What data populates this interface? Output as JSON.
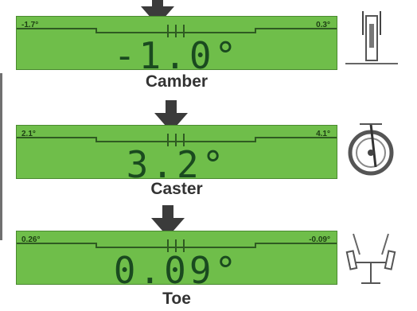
{
  "readouts": [
    {
      "id": "camber",
      "label": "Camber",
      "value": "-1.0°",
      "min_label": "-1.7°",
      "max_label": "0.3°"
    },
    {
      "id": "caster",
      "label": "Caster",
      "value": "3.2°",
      "min_label": "2.1°",
      "max_label": "4.1°"
    },
    {
      "id": "toe",
      "label": "Toe",
      "value": "0.09°",
      "min_label": "0.26°",
      "max_label": "-0.09°"
    }
  ],
  "colors": {
    "gauge_bg": "#6fbe4a",
    "gauge_text": "#1a4a1f",
    "arrow": "#3b3b3b"
  },
  "icons": [
    "camber-wheel-icon",
    "caster-wheel-icon",
    "toe-wheels-icon"
  ]
}
